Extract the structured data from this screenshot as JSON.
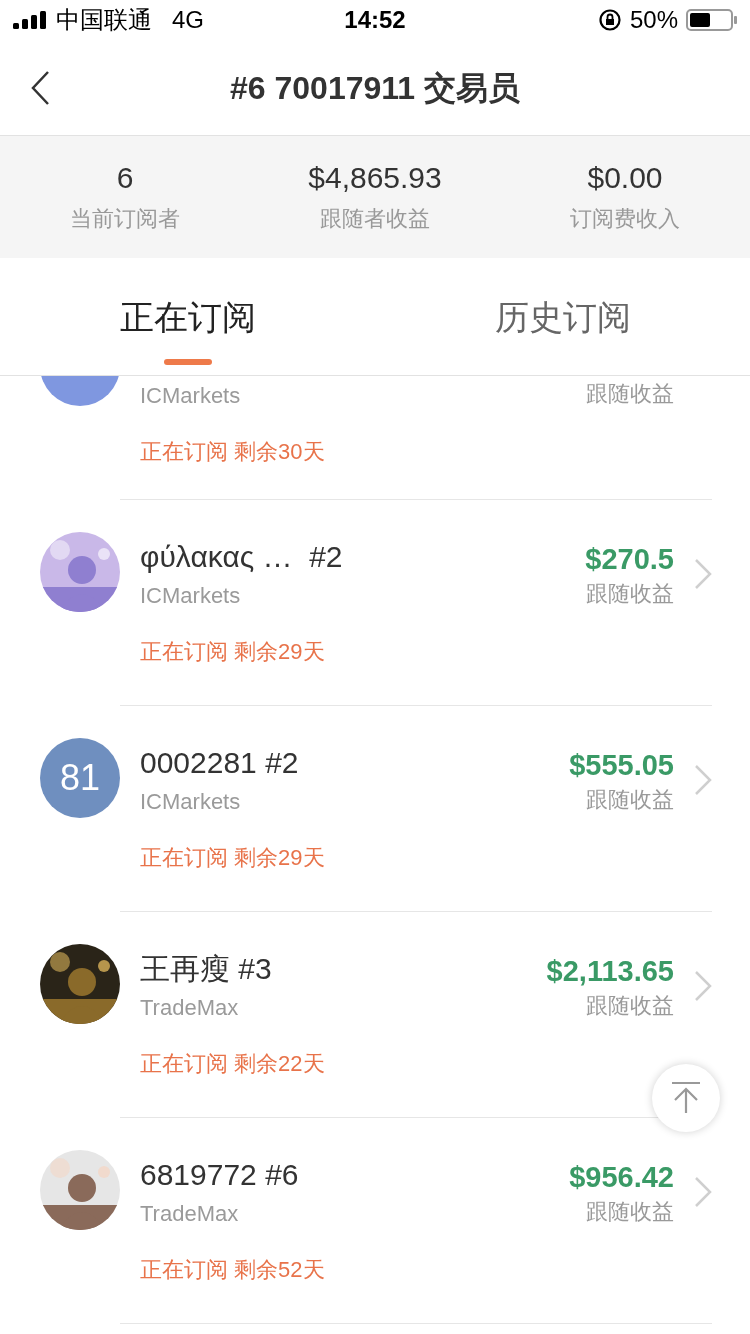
{
  "status_bar": {
    "carrier": "中国联通",
    "network": "4G",
    "time": "14:52",
    "battery": "50%"
  },
  "nav": {
    "title": "#6 70017911 交易员"
  },
  "stats": [
    {
      "value": "6",
      "label": "当前订阅者"
    },
    {
      "value": "$4,865.93",
      "label": "跟随者收益"
    },
    {
      "value": "$0.00",
      "label": "订阅费收入"
    }
  ],
  "tabs": [
    {
      "label": "正在订阅",
      "selected": true
    },
    {
      "label": "历史订阅",
      "selected": false
    }
  ],
  "subscribers": [
    {
      "kind": "partial",
      "avatar": {
        "kind": "initials",
        "color": "#7f97e0"
      },
      "broker": "ICMarkets",
      "profit_label": "跟随收益",
      "status": "正在订阅 剩余30天"
    },
    {
      "kind": "full",
      "name": "φύλακας …  #2",
      "broker": "ICMarkets",
      "profit": "$270.5",
      "profit_label": "跟随收益",
      "status": "正在订阅 剩余29天"
    },
    {
      "kind": "full",
      "avatar": {
        "kind": "initials",
        "color": "#6f8fbf",
        "text": "81"
      },
      "name": "0002281 #2",
      "broker": "ICMarkets",
      "profit": "$555.05",
      "profit_label": "跟随收益",
      "status": "正在订阅 剩余29天"
    },
    {
      "kind": "full",
      "name": "王再瘦 #3",
      "broker": "TradeMax",
      "profit": "$2,113.65",
      "profit_label": "跟随收益",
      "status": "正在订阅 剩余22天"
    },
    {
      "kind": "full",
      "name": "6819772 #6",
      "broker": "TradeMax",
      "profit": "$956.42",
      "profit_label": "跟随收益",
      "status": "正在订阅 剩余52天"
    }
  ]
}
